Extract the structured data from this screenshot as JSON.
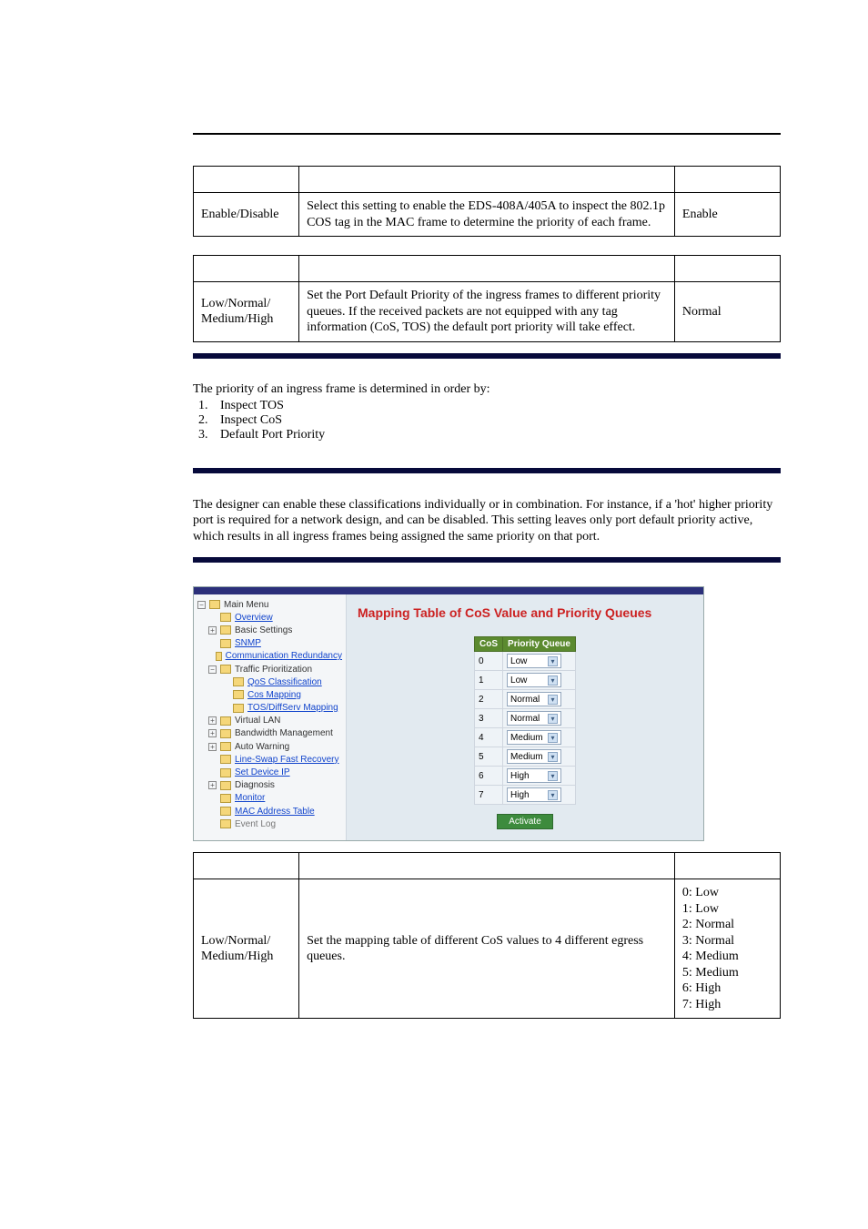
{
  "table1": {
    "setting": "Enable/Disable",
    "desc": "Select this setting to enable the EDS-408A/405A to inspect the 802.1p COS tag in the MAC frame to determine the priority of each frame.",
    "default": "Enable"
  },
  "table2": {
    "setting": "Low/Normal/\nMedium/High",
    "desc": "Set the Port Default Priority of the ingress frames to different priority queues. If the received packets are not equipped with any tag information (CoS, TOS) the default port priority will take effect.",
    "default": "Normal"
  },
  "ordered_intro": "The priority of an ingress frame is determined in order by:",
  "ordered_items": [
    "Inspect TOS",
    "Inspect CoS",
    "Default Port Priority"
  ],
  "para_mid_pre": "The designer can enable these classifications individually or in combination. For instance, if a 'hot' higher priority port is required for a network design, ",
  "para_mid_and": " and ",
  "para_mid_post": " can be disabled. This setting leaves only port default priority active, which results in all ingress frames being assigned the same priority on that port.",
  "shot": {
    "title": "Mapping Table of CoS Value and Priority Queues",
    "menu": {
      "main": "Main Menu",
      "overview": "Overview",
      "basic": "Basic Settings",
      "snmp": "SNMP",
      "commred": "Communication Redundancy",
      "traffic": "Traffic Prioritization",
      "qosclass": "QoS Classification",
      "cosmap": "Cos Mapping",
      "tosmap": "TOS/DiffServ Mapping",
      "vlan": "Virtual LAN",
      "bwm": "Bandwidth Management",
      "autowarn": "Auto Warning",
      "lineswap": "Line-Swap Fast Recovery",
      "setdev": "Set Device IP",
      "diag": "Diagnosis",
      "monitor": "Monitor",
      "mactbl": "MAC Address Table",
      "eventlog": "Event Log"
    },
    "headers": {
      "cos": "CoS",
      "pq": "Priority Queue"
    },
    "rows": [
      {
        "cos": "0",
        "val": "Low"
      },
      {
        "cos": "1",
        "val": "Low"
      },
      {
        "cos": "2",
        "val": "Normal"
      },
      {
        "cos": "3",
        "val": "Normal"
      },
      {
        "cos": "4",
        "val": "Medium"
      },
      {
        "cos": "5",
        "val": "Medium"
      },
      {
        "cos": "6",
        "val": "High"
      },
      {
        "cos": "7",
        "val": "High"
      }
    ],
    "activate": "Activate"
  },
  "table3": {
    "setting": "Low/Normal/\nMedium/High",
    "desc": "Set the mapping table of different CoS values to 4 different egress queues.",
    "defaults": [
      "0: Low",
      "1: Low",
      "2: Normal",
      "3: Normal",
      "4: Medium",
      "5: Medium",
      "6: High",
      "7: High"
    ]
  }
}
